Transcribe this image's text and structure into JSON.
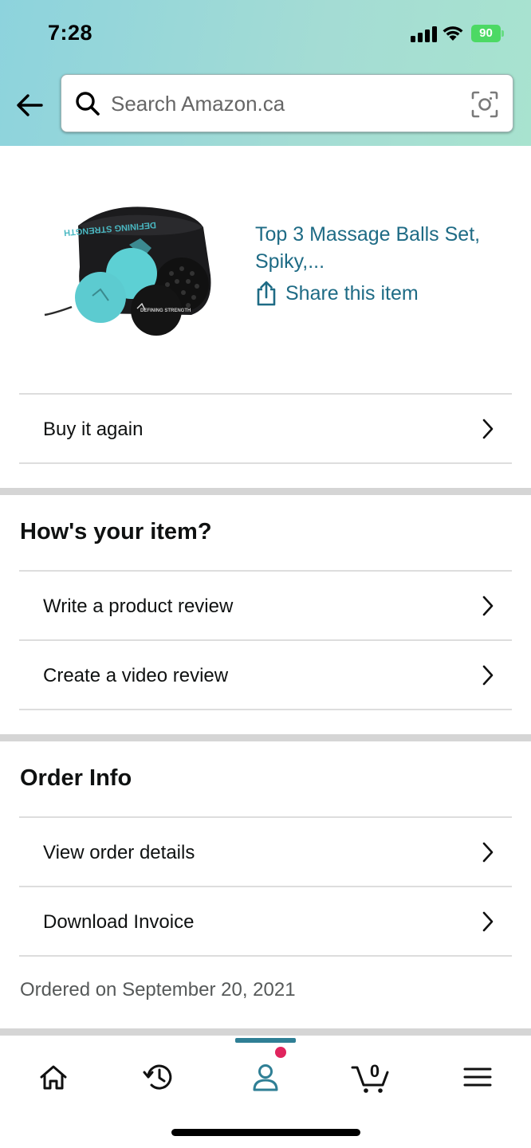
{
  "status_bar": {
    "time": "7:28",
    "battery": "90"
  },
  "search": {
    "placeholder": "Search Amazon.ca"
  },
  "product": {
    "title": "Top 3 Massage Balls Set, Spiky,...",
    "share_label": "Share this item",
    "bag_text": "DEFINING STRENGTH"
  },
  "actions": {
    "buy_again": "Buy it again"
  },
  "review_section": {
    "title": "How's your item?",
    "items": [
      {
        "label": "Write a product review"
      },
      {
        "label": "Create a video review"
      }
    ]
  },
  "order_section": {
    "title": "Order Info",
    "items": [
      {
        "label": "View order details"
      },
      {
        "label": "Download Invoice"
      }
    ],
    "ordered_on": "Ordered on September 20, 2021"
  },
  "bottom_nav": {
    "items": [
      {
        "icon": "home-icon"
      },
      {
        "icon": "history-icon"
      },
      {
        "icon": "account-icon",
        "active": true
      },
      {
        "icon": "cart-icon"
      },
      {
        "icon": "menu-icon"
      }
    ],
    "cart_count": "0"
  },
  "colors": {
    "link": "#1e6b85",
    "accent": "#2f7f95",
    "notification": "#e0245e",
    "battery": "#4cd964"
  }
}
